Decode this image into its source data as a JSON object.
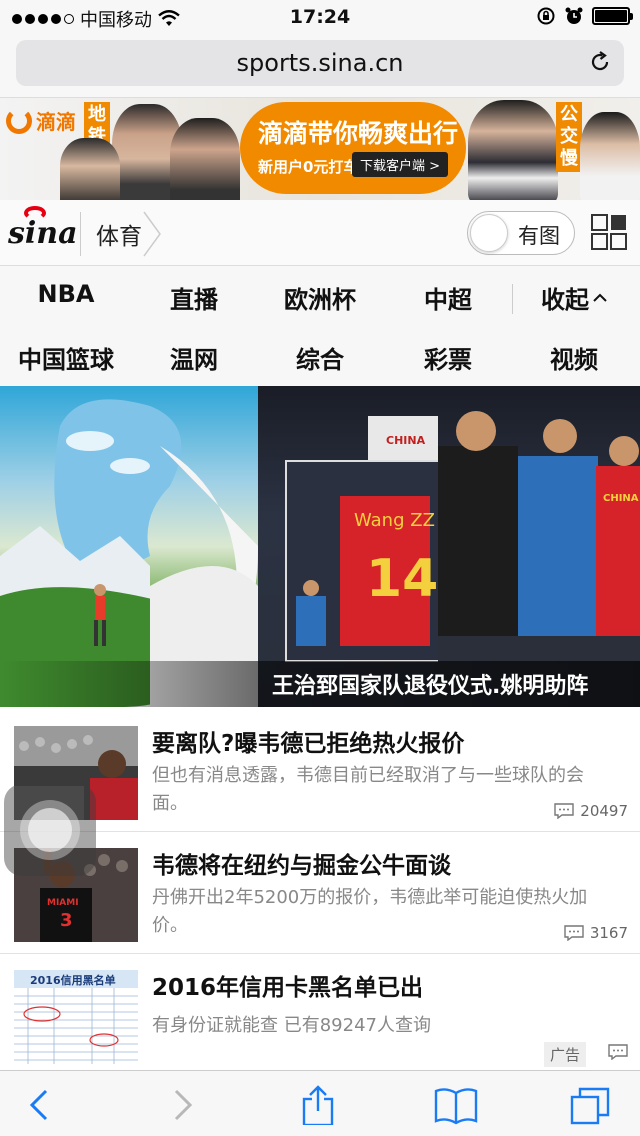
{
  "status_bar": {
    "carrier": "中国移动",
    "time": "17:24"
  },
  "browser": {
    "url": "sports.sina.cn"
  },
  "ad_banner": {
    "brand": "滴滴",
    "tag_left": "地铁挤",
    "tag_right": "公交慢",
    "headline": "滴滴带你畅爽出行",
    "sub": "新用户0元打车",
    "download": "下载客户端 >"
  },
  "header": {
    "logo": "sina",
    "section": "体育",
    "image_toggle_label": "有图"
  },
  "nav": {
    "row1": [
      "NBA",
      "直播",
      "欧洲杯",
      "中超",
      "收起"
    ],
    "row2": [
      "中国篮球",
      "温网",
      "综合",
      "彩票",
      "视频"
    ]
  },
  "hero": {
    "caption": "王治郅国家队退役仪式.姚明助阵",
    "jersey_name": "Wang ZZ",
    "jersey_number": "14",
    "jersey_top": "CHINA",
    "shirt_text": "CHINA"
  },
  "news": [
    {
      "title": "要离队?曝韦德已拒绝热火报价",
      "summary": "但也有消息透露，韦德目前已经取消了与一些球队的会面。",
      "comments": "20497"
    },
    {
      "title": "韦德将在纽约与掘金公牛面谈",
      "summary": "丹佛开出2年5200万的报价，韦德此举可能迫使热火加价。",
      "comments": "3167",
      "jersey": "MIAMI",
      "jersey_number": "3"
    },
    {
      "title": "2016年信用卡黑名单已出",
      "summary": "有身份证就能查 已有89247人查询",
      "ad_label": "广告",
      "thumb_title": "2016信用黑名单"
    }
  ]
}
